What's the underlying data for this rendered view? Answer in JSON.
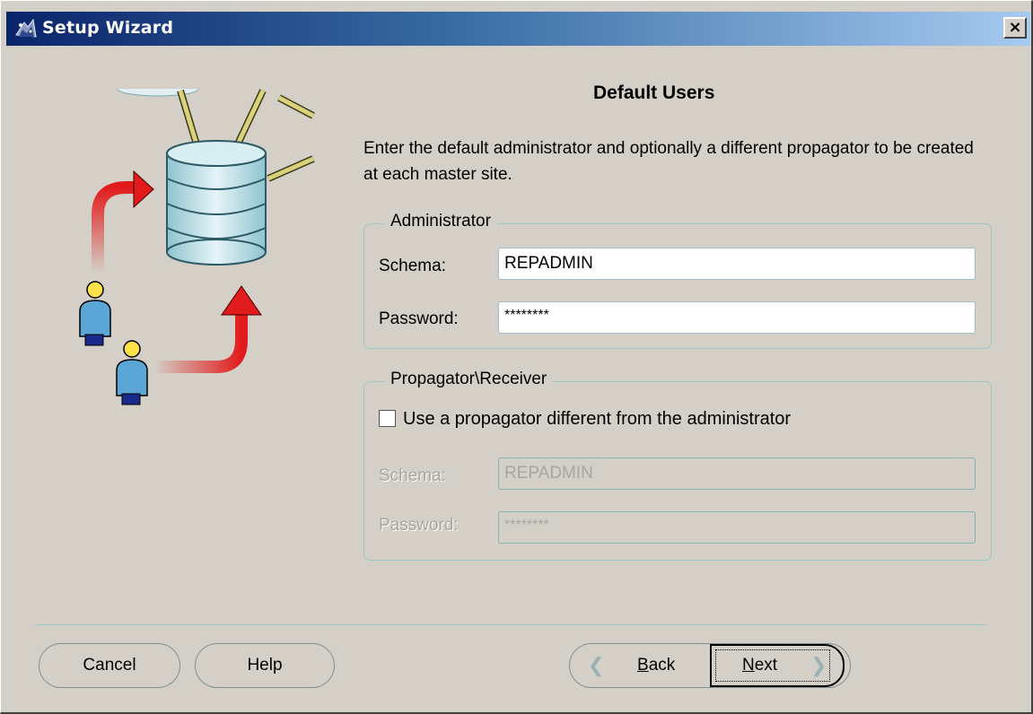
{
  "window": {
    "title": "Setup Wizard",
    "close_label": "×"
  },
  "page": {
    "heading": "Default Users",
    "description": "Enter the default administrator and optionally a different propagator to be created at each master site."
  },
  "administrator": {
    "legend": "Administrator",
    "schema_label": "Schema:",
    "schema_value": "REPADMIN",
    "password_label": "Password:",
    "password_value": "********"
  },
  "propagator": {
    "legend": "Propagator\\Receiver",
    "checkbox_label": "Use a propagator different from the administrator",
    "checkbox_checked": false,
    "schema_label": "Schema:",
    "schema_value": "REPADMIN",
    "password_label": "Password:",
    "password_value": "********",
    "enabled": false
  },
  "buttons": {
    "cancel": "Cancel",
    "help": "Help",
    "back_mnemonic": "B",
    "back_rest": "ack",
    "next_mnemonic": "N",
    "next_rest": "ext"
  },
  "icons": {
    "title": "wizard-icon",
    "back": "chevron-left-icon",
    "next": "chevron-right-icon"
  },
  "colors": {
    "titlebar_start": "#0a246a",
    "titlebar_end": "#a6caf0",
    "arrow_red": "#e11b1b",
    "database": "#b7dde4",
    "group_border": "#9bc7c7"
  }
}
